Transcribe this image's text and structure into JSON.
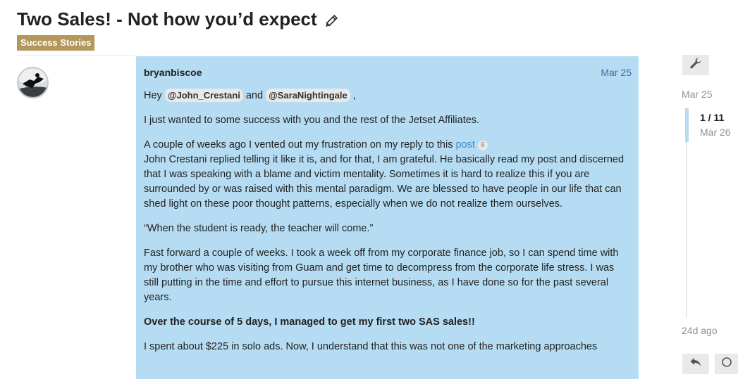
{
  "topic": {
    "title": "Two Sales! - Not how you’d expect",
    "category": "Success Stories",
    "category_color": "#b3975b"
  },
  "post": {
    "username": "bryanbiscoe",
    "date": "Mar 25",
    "greeting_prefix": "Hey ",
    "mention_1": "@John_Crestani",
    "greeting_and": " and ",
    "mention_2": "@SaraNightingale",
    "greeting_suffix": " ,",
    "p1": "I just wanted to some success with you and the rest of the Jetset Affiliates.",
    "p2_prefix": "A couple of weeks ago I vented out my frustration on my reply to this ",
    "p2_link": "post",
    "p2_link_count": "8",
    "p2_rest": "John Crestani replied telling it like it is, and for that, I am grateful. He basically read my post and discerned that I was speaking with a blame and victim mentality. Sometimes it is hard to realize this if you are surrounded by or was raised with this mental paradigm. We are blessed to have people in our life that can shed light on these poor thought patterns, especially when we do not realize them ourselves.",
    "p3": "“When the student is ready, the teacher will come.”",
    "p4": "Fast forward a couple of weeks. I took a week off from my corporate finance job, so I can spend time with my brother who was visiting from Guam and get time to decompress from the corporate life stress. I was still putting in the time and effort to pursue this internet business, as I have done so for the past several years.",
    "p5": "Over the course of 5 days, I managed to get my first two SAS sales!!",
    "p6": "I spent about $225 in solo ads. Now, I understand that this was not one of the marketing approaches",
    "background_color": "#b5dcf2"
  },
  "timeline": {
    "start_date": "Mar 25",
    "position": "1 / 11",
    "position_date": "Mar 26",
    "end_label": "24d ago"
  },
  "icons": {
    "edit": "pencil-icon",
    "admin": "wrench-icon",
    "reply": "reply-icon",
    "notifications": "circle-icon"
  }
}
